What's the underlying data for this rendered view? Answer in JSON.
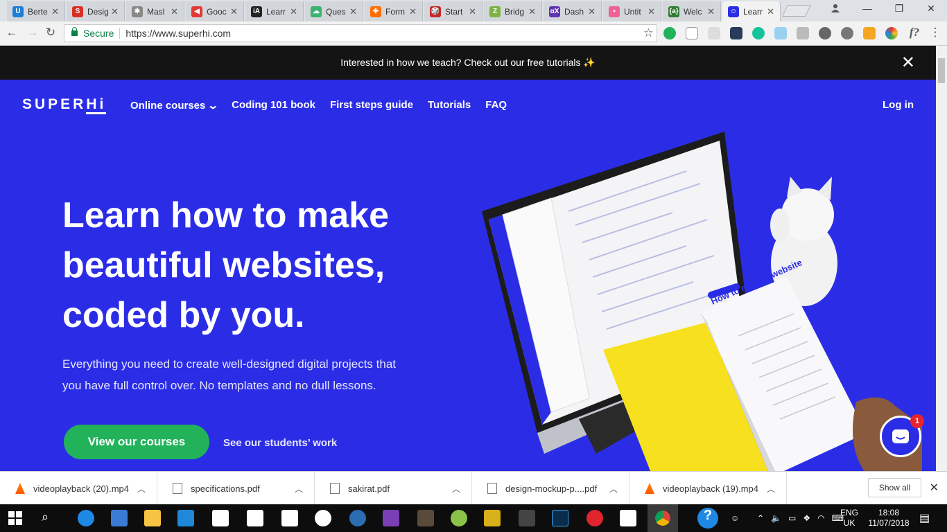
{
  "browser": {
    "tabs": [
      {
        "title": "Berte",
        "color": "#1f7fd6",
        "glyph": "U"
      },
      {
        "title": "Desig",
        "color": "#d93025",
        "glyph": "S"
      },
      {
        "title": "Masl",
        "color": "#888888",
        "glyph": "✱"
      },
      {
        "title": "Gooc",
        "color": "#e53935",
        "glyph": "◀"
      },
      {
        "title": "Learr",
        "color": "#222222",
        "glyph": "iA"
      },
      {
        "title": "Ques",
        "color": "#3cb371",
        "glyph": "☁"
      },
      {
        "title": "Form",
        "color": "#ff6d00",
        "glyph": "✚"
      },
      {
        "title": "Start",
        "color": "#c62828",
        "glyph": "🎲"
      },
      {
        "title": "Bridg",
        "color": "#7cb342",
        "glyph": "Z"
      },
      {
        "title": "Dash",
        "color": "#5e35b1",
        "glyph": "αX"
      },
      {
        "title": "Untit",
        "color": "#f06292",
        "glyph": "▪"
      },
      {
        "title": "Welc",
        "color": "#2e7d32",
        "glyph": "{a}"
      },
      {
        "title": "Learr",
        "color": "#2b2de6",
        "glyph": "☺"
      }
    ],
    "secure_label": "Secure",
    "url": "https://www.superhi.com"
  },
  "banner": {
    "text": "Interested in how we teach? Check out our free tutorials ✨"
  },
  "header": {
    "logo_super": "SUPER",
    "logo_hi": "Hi",
    "nav": [
      "Online courses",
      "Coding 101 book",
      "First steps guide",
      "Tutorials",
      "FAQ"
    ],
    "login": "Log in"
  },
  "hero": {
    "headline_1": "Learn how to make",
    "headline_2": "beautiful websites,",
    "headline_3": "coded by you.",
    "subtext_1": "Everything you need to create well-designed digital projects that",
    "subtext_2": "you have full control over. No templates and no dull lessons.",
    "cta": "View our courses",
    "secondary_link": "See our students’ work",
    "book_title": "How to make a website"
  },
  "chat": {
    "badge": "1"
  },
  "downloads": {
    "items": [
      {
        "name": "videoplayback (20).mp4",
        "type": "video"
      },
      {
        "name": "specifications.pdf",
        "type": "pdf"
      },
      {
        "name": "sakirat.pdf",
        "type": "pdf"
      },
      {
        "name": "design-mockup-p....pdf",
        "type": "pdf"
      },
      {
        "name": "videoplayback (19).mp4",
        "type": "video"
      }
    ],
    "show_all": "Show all"
  },
  "taskbar": {
    "lang_1": "ENG",
    "lang_2": "UK",
    "time": "18:08",
    "date": "11/07/2018"
  },
  "colors": {
    "hero_bg": "#2b2de6",
    "cta_green": "#21b25a",
    "banner_bg": "#141414",
    "book_yellow": "#f7e01d"
  }
}
